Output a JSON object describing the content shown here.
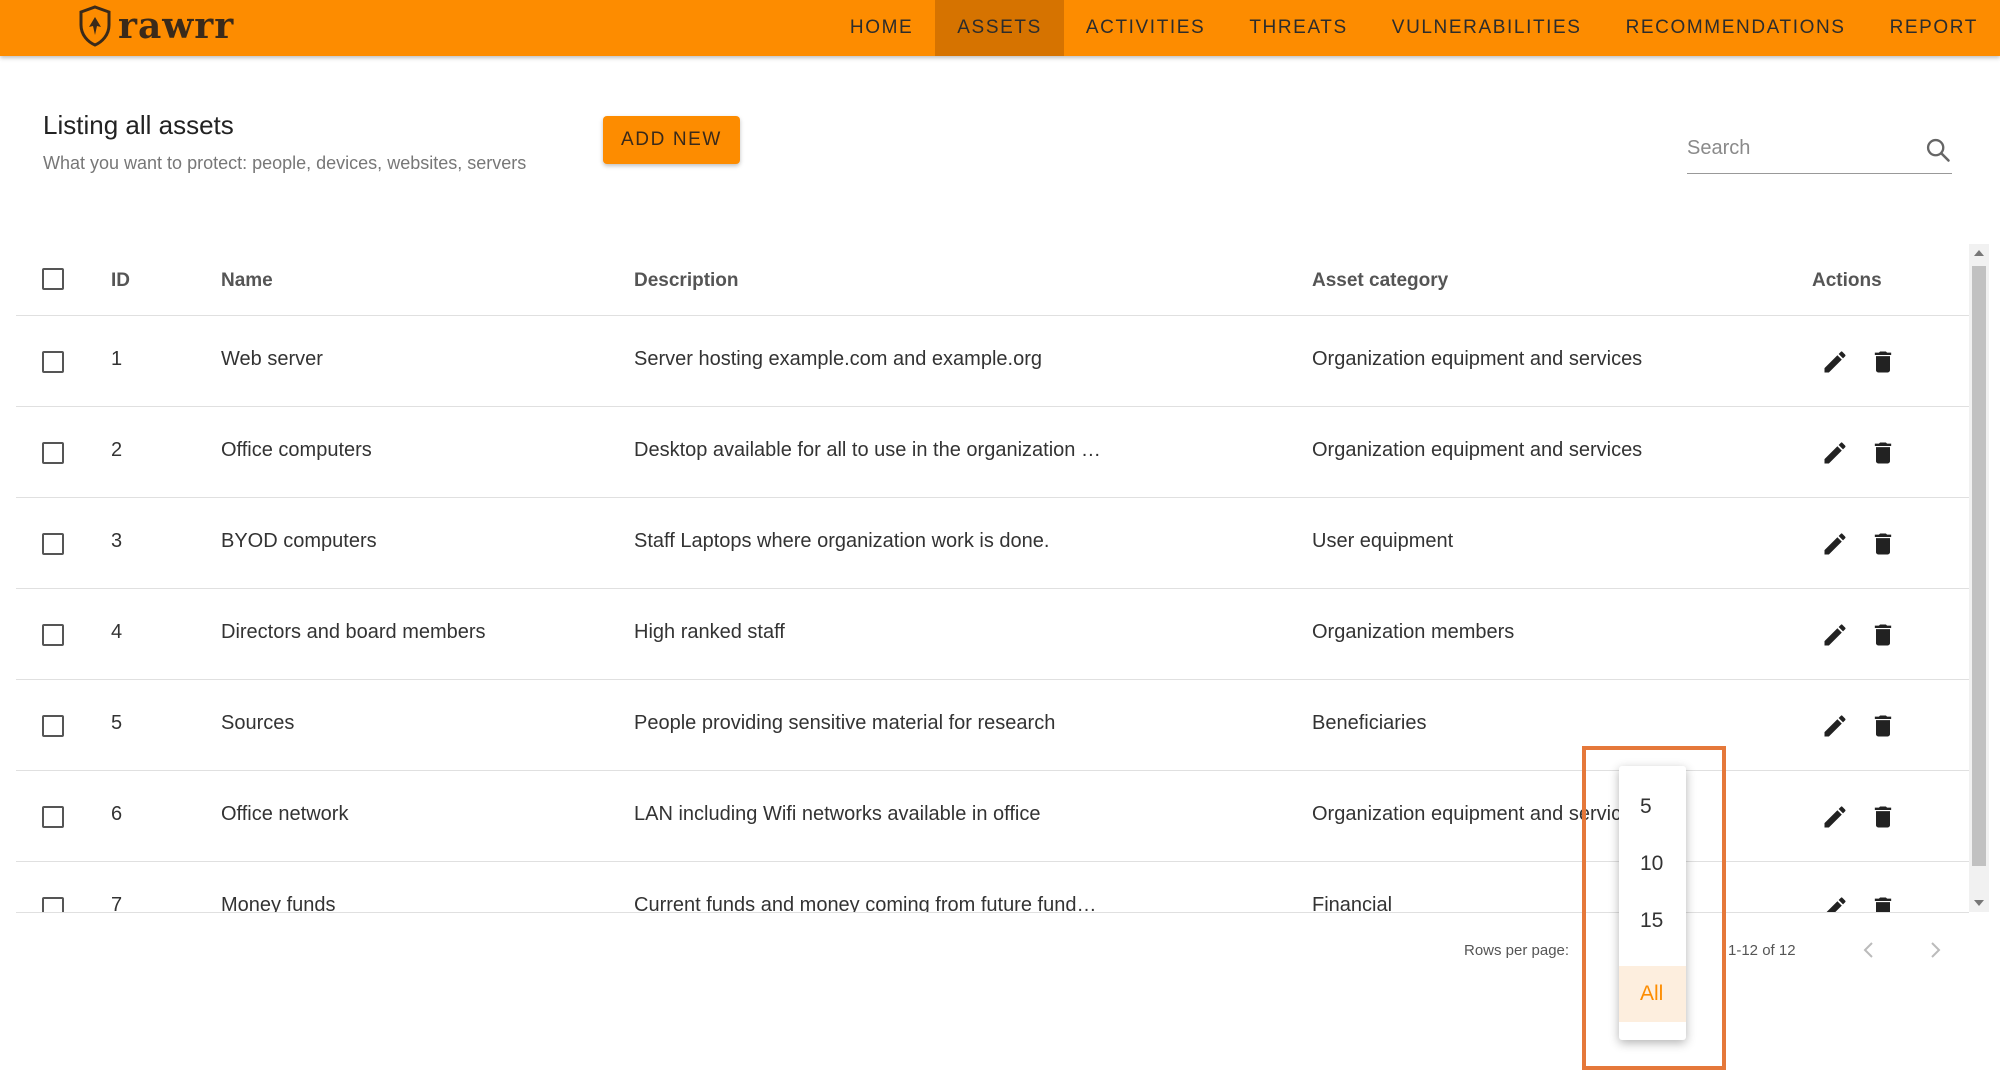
{
  "app": {
    "logo_text": "rawrr"
  },
  "nav": {
    "items": [
      "HOME",
      "ASSETS",
      "ACTIVITIES",
      "THREATS",
      "VULNERABILITIES",
      "RECOMMENDATIONS",
      "REPORT"
    ],
    "active": "ASSETS"
  },
  "page": {
    "title": "Listing all assets",
    "subtitle": "What you want to protect: people, devices, websites, servers",
    "add_label": "ADD NEW"
  },
  "search": {
    "placeholder": "Search"
  },
  "table": {
    "columns": [
      "ID",
      "Name",
      "Description",
      "Asset category",
      "Actions"
    ],
    "rows": [
      {
        "id": "1",
        "name": "Web server",
        "description": "Server hosting example.com and example.org",
        "category": "Organization equipment and services"
      },
      {
        "id": "2",
        "name": "Office computers",
        "description": "Desktop available for all to use in the organization …",
        "category": "Organization equipment and services"
      },
      {
        "id": "3",
        "name": "BYOD computers",
        "description": "Staff Laptops where organization work is done.",
        "category": "User equipment"
      },
      {
        "id": "4",
        "name": "Directors and board members",
        "description": "High ranked staff",
        "category": "Organization members"
      },
      {
        "id": "5",
        "name": "Sources",
        "description": "People providing sensitive material for research",
        "category": "Beneficiaries"
      },
      {
        "id": "6",
        "name": "Office network",
        "description": "LAN including Wifi networks available in office",
        "category": "Organization equipment and services"
      },
      {
        "id": "7",
        "name": "Money funds",
        "description": "Current funds and money coming from future fund…",
        "category": "Financial"
      }
    ]
  },
  "pagination": {
    "rows_label": "Rows per page:",
    "range": "1-12 of 12",
    "options": [
      "5",
      "10",
      "15",
      "All"
    ],
    "selected": "All"
  },
  "icons": {
    "edit": "pencil-icon",
    "delete": "trash-icon",
    "search": "search-icon",
    "prev": "chevron-left-icon",
    "next": "chevron-right-icon"
  },
  "colors": {
    "accent": "#fd8c00",
    "accent_dark": "#d67300",
    "highlight": "#e5783a"
  }
}
